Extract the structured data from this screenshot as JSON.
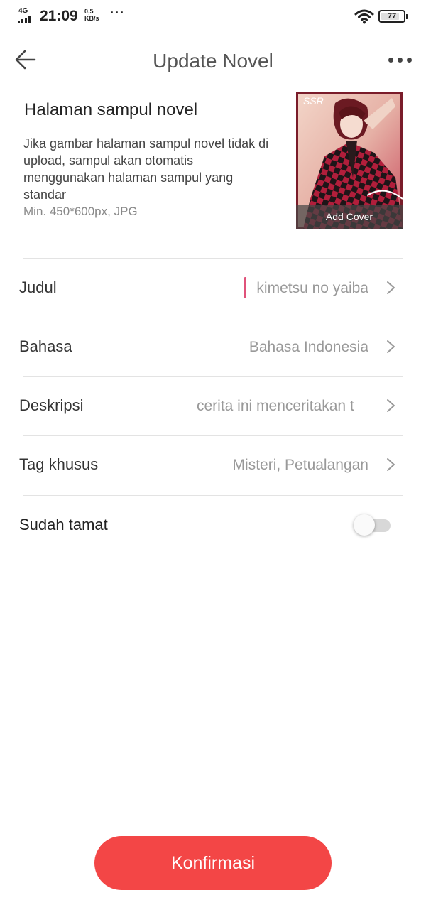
{
  "status_bar": {
    "network": "4G",
    "time": "21:09",
    "speed_value": "0,5",
    "speed_unit": "KB/s",
    "more": "···",
    "battery": "77",
    "icons": [
      "signal-icon",
      "wifi-icon",
      "battery-icon"
    ]
  },
  "header": {
    "title": "Update Novel",
    "back_icon": "arrow-left-icon",
    "more_icon": "more-horizontal-icon"
  },
  "cover": {
    "heading": "Halaman sampul novel",
    "description": "Jika gambar halaman sampul novel tidak di upload, sampul akan otomatis menggunakan halaman sampul yang standar",
    "spec": "Min. 450*600px, JPG",
    "badge": "SSR",
    "add_label": "Add Cover"
  },
  "form": {
    "rows": [
      {
        "label": "Judul",
        "value": "kimetsu no yaiba"
      },
      {
        "label": "Bahasa",
        "value": "Bahasa Indonesia"
      },
      {
        "label": "Deskripsi",
        "value": "cerita ini menceritakan t"
      },
      {
        "label": "Tag khusus",
        "value": "Misteri, Petualangan"
      }
    ],
    "completed": {
      "label": "Sudah tamat",
      "on": false
    }
  },
  "actions": {
    "confirm_label": "Konfirmasi"
  },
  "colors": {
    "accent": "#f34646",
    "caret": "#e0527a",
    "divider": "#e3e3e3"
  }
}
